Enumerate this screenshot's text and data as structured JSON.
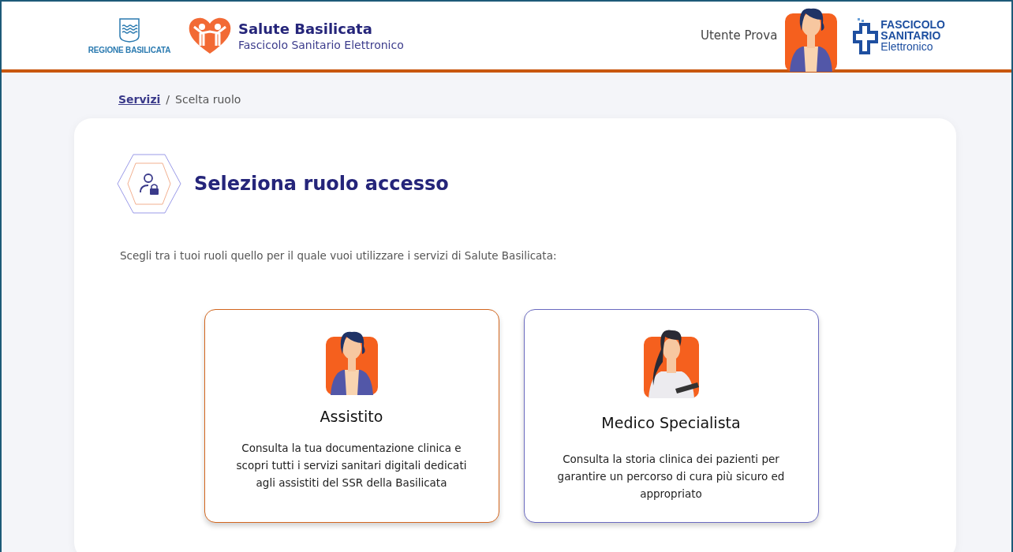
{
  "header": {
    "region_name": "REGIONE BASILICATA",
    "app_title": "Salute Basilicata",
    "app_subtitle": "Fascicolo Sanitario Elettronico",
    "user_name": "Utente Prova",
    "fse_logo": {
      "line1": "FASCICOLO",
      "line2": "SANITARIO",
      "line3": "Elettronico"
    }
  },
  "breadcrumb": [
    {
      "label": "Servizi",
      "kind": "link"
    },
    {
      "label": "/",
      "kind": "separator"
    },
    {
      "label": "Scelta ruolo",
      "kind": "current"
    }
  ],
  "title": "Seleziona ruolo accesso",
  "description": "Scegli tra i tuoi ruoli quello per il quale vuoi utilizzare i servizi di Salute Basilicata:",
  "roles": [
    {
      "kind": "patient",
      "name": "Assistito",
      "text": "Consulta la tua documentazione clinica e scopri tutti i servizi sanitari digitali dedicati agli assistiti del SSR della Basilicata",
      "selected": true
    },
    {
      "kind": "doctor",
      "name": "Medico Specialista",
      "text": "Consulta la storia clinica dei pazienti per garantire un percorso di cura più sicuro ed appropriato",
      "selected": false
    }
  ]
}
